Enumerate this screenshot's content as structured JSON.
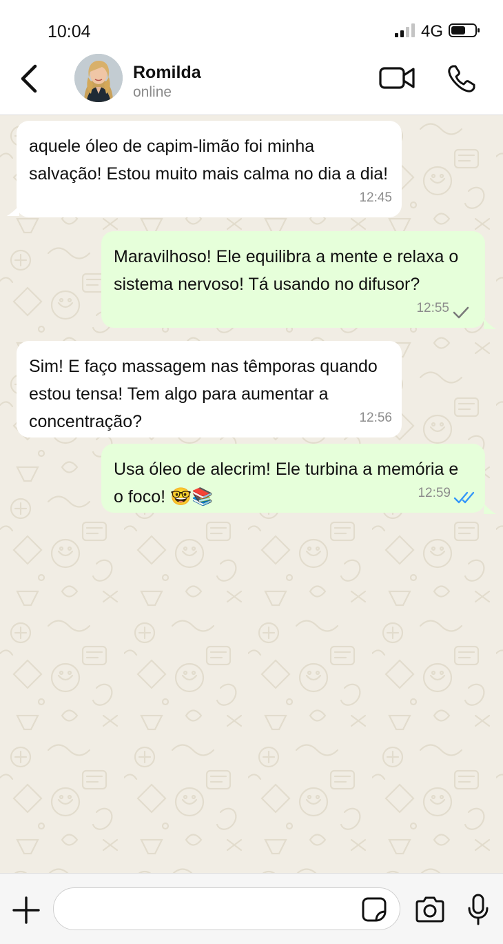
{
  "status_bar": {
    "time": "10:04",
    "network": "4G"
  },
  "contact": {
    "name": "Romilda",
    "status": "online"
  },
  "messages": [
    {
      "direction": "in",
      "text": "aquele óleo de capim-limão foi minha salvação! Estou muito mais calma no dia a dia!",
      "time": "12:45"
    },
    {
      "direction": "out",
      "text": "Maravilhoso! Ele equilibra a mente e relaxa o sistema nervoso! Tá usando no difusor?",
      "time": "12:55",
      "ticks": "single-grey"
    },
    {
      "direction": "in",
      "text": "Sim! E faço massagem nas têmporas quando estou tensa! Tem algo para aumentar a concentração?",
      "time": "12:56"
    },
    {
      "direction": "out",
      "text": "Usa óleo de alecrim! Ele turbina a memória e o foco! 🤓📚",
      "time": "12:59",
      "ticks": "double-blue"
    }
  ],
  "composer": {
    "input_value": ""
  },
  "colors": {
    "outgoing_bubble": "#e6ffda",
    "incoming_bubble": "#ffffff",
    "wallpaper": "#f1ede4",
    "read_ticks": "#3497f9"
  },
  "icons": {
    "back": "chevron-left-icon",
    "video": "video-camera-icon",
    "call": "phone-icon",
    "plus": "plus-icon",
    "sticker": "sticker-icon",
    "camera": "camera-icon",
    "mic": "microphone-icon"
  }
}
